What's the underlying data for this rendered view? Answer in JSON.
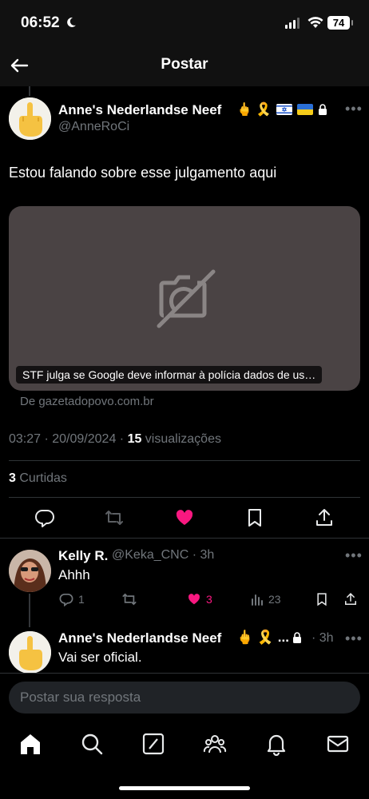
{
  "status_bar": {
    "time": "06:52",
    "battery": "74"
  },
  "header": {
    "title": "Postar"
  },
  "post": {
    "author_name": "Anne's Nederlandse Neef",
    "author_handle": "@AnneRoCi",
    "emojis": "🖕 🎗️",
    "text": "Estou falando sobre esse julgamento aqui",
    "card": {
      "caption": "STF julga se Google deve informar à polícia dados de us…",
      "source": "De gazetadopovo.com.br"
    },
    "timestamp": "03:27 · 20/09/2024 · ",
    "views_count": "15",
    "views_label": " visualizações",
    "likes_count": "3",
    "likes_label": " Curtidas"
  },
  "replies": [
    {
      "author_name": "Kelly R.",
      "handle_time": "@Keka_CNC · 3h",
      "text": "Ahhh",
      "reply_count": "1",
      "like_count": "3",
      "view_count": "23"
    },
    {
      "author_name": "Anne's Nederlandse Neef",
      "emojis": "🖕 🎗️ ...",
      "time": "· 3h",
      "text": "Vai ser oficial."
    }
  ],
  "reply_input": {
    "placeholder": "Postar sua resposta"
  },
  "colors": {
    "like": "#f91880",
    "background": "#000000",
    "card": "#4a4344",
    "muted": "#71767b"
  }
}
